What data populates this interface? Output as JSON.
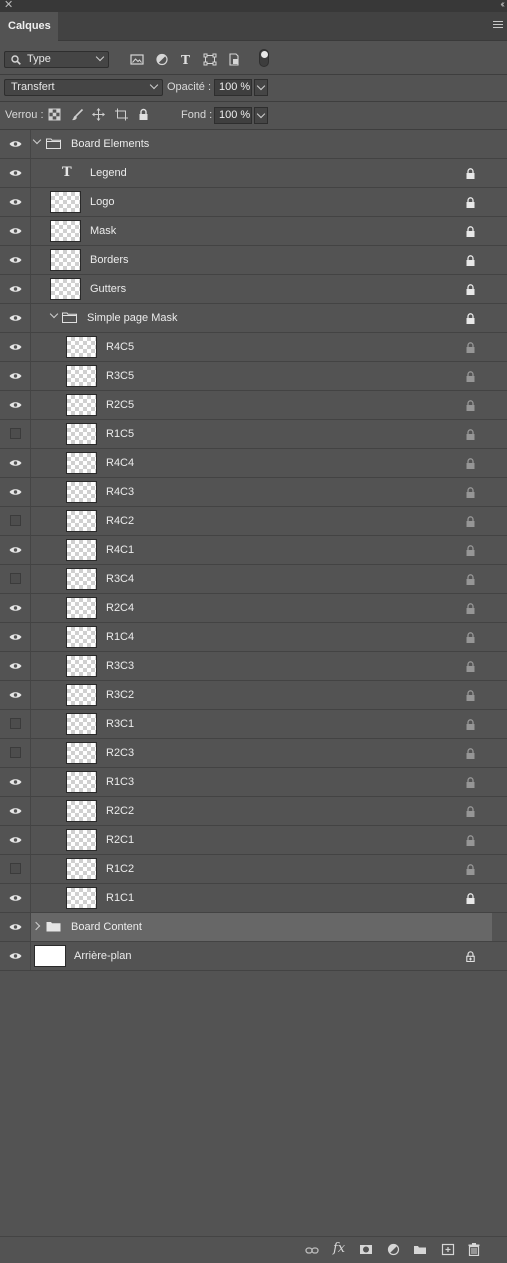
{
  "window": {
    "close_glyph": "✕",
    "collapse_glyph": "‹‹"
  },
  "panel": {
    "tab_label": "Calques"
  },
  "filter": {
    "kind_value": "Type"
  },
  "blend": {
    "mode_value": "Transfert",
    "opacity_label": "Opacité :",
    "opacity_value": "100 %"
  },
  "lock": {
    "label": "Verrou :",
    "fill_label": "Fond :",
    "fill_value": "100 %"
  },
  "layers": [
    {
      "name": "Board Elements",
      "kind": "group",
      "open": true,
      "indent": 0,
      "visible": true,
      "lock": "none"
    },
    {
      "name": "Legend",
      "kind": "text",
      "indent": 1,
      "visible": true,
      "lock": "full"
    },
    {
      "name": "Logo",
      "kind": "image",
      "indent": 1,
      "visible": true,
      "lock": "full"
    },
    {
      "name": "Mask",
      "kind": "image",
      "indent": 1,
      "visible": true,
      "lock": "full"
    },
    {
      "name": "Borders",
      "kind": "image",
      "indent": 1,
      "visible": true,
      "lock": "full"
    },
    {
      "name": "Gutters",
      "kind": "image",
      "indent": 1,
      "visible": true,
      "lock": "full"
    },
    {
      "name": "Simple page Mask",
      "kind": "group",
      "open": true,
      "indent": 1,
      "visible": true,
      "lock": "full"
    },
    {
      "name": "R4C5",
      "kind": "image",
      "indent": 2,
      "visible": true,
      "lock": "partial"
    },
    {
      "name": "R3C5",
      "kind": "image",
      "indent": 2,
      "visible": true,
      "lock": "partial"
    },
    {
      "name": "R2C5",
      "kind": "image",
      "indent": 2,
      "visible": true,
      "lock": "partial"
    },
    {
      "name": "R1C5",
      "kind": "image",
      "indent": 2,
      "visible": false,
      "lock": "partial"
    },
    {
      "name": "R4C4",
      "kind": "image",
      "indent": 2,
      "visible": true,
      "lock": "partial"
    },
    {
      "name": "R4C3",
      "kind": "image",
      "indent": 2,
      "visible": true,
      "lock": "partial"
    },
    {
      "name": "R4C2",
      "kind": "image",
      "indent": 2,
      "visible": false,
      "lock": "partial"
    },
    {
      "name": "R4C1",
      "kind": "image",
      "indent": 2,
      "visible": true,
      "lock": "partial"
    },
    {
      "name": "R3C4",
      "kind": "image",
      "indent": 2,
      "visible": false,
      "lock": "partial"
    },
    {
      "name": "R2C4",
      "kind": "image",
      "indent": 2,
      "visible": true,
      "lock": "partial"
    },
    {
      "name": "R1C4",
      "kind": "image",
      "indent": 2,
      "visible": true,
      "lock": "partial"
    },
    {
      "name": "R3C3",
      "kind": "image",
      "indent": 2,
      "visible": true,
      "lock": "partial"
    },
    {
      "name": "R3C2",
      "kind": "image",
      "indent": 2,
      "visible": true,
      "lock": "partial"
    },
    {
      "name": "R3C1",
      "kind": "image",
      "indent": 2,
      "visible": false,
      "lock": "partial"
    },
    {
      "name": "R2C3",
      "kind": "image",
      "indent": 2,
      "visible": false,
      "lock": "partial"
    },
    {
      "name": "R1C3",
      "kind": "image",
      "indent": 2,
      "visible": true,
      "lock": "partial"
    },
    {
      "name": "R2C2",
      "kind": "image",
      "indent": 2,
      "visible": true,
      "lock": "partial"
    },
    {
      "name": "R2C1",
      "kind": "image",
      "indent": 2,
      "visible": true,
      "lock": "partial"
    },
    {
      "name": "R1C2",
      "kind": "image",
      "indent": 2,
      "visible": false,
      "lock": "partial"
    },
    {
      "name": "R1C1",
      "kind": "image",
      "indent": 2,
      "visible": true,
      "lock": "full"
    },
    {
      "name": "Board Content",
      "kind": "group",
      "open": false,
      "indent": 0,
      "visible": true,
      "lock": "none",
      "selected": true
    },
    {
      "name": "Arrière-plan",
      "kind": "background",
      "indent": 0,
      "visible": true,
      "lock": "position"
    }
  ],
  "colors": {
    "panel": "#535353",
    "selected_row": "#676767",
    "text": "#ececec"
  }
}
